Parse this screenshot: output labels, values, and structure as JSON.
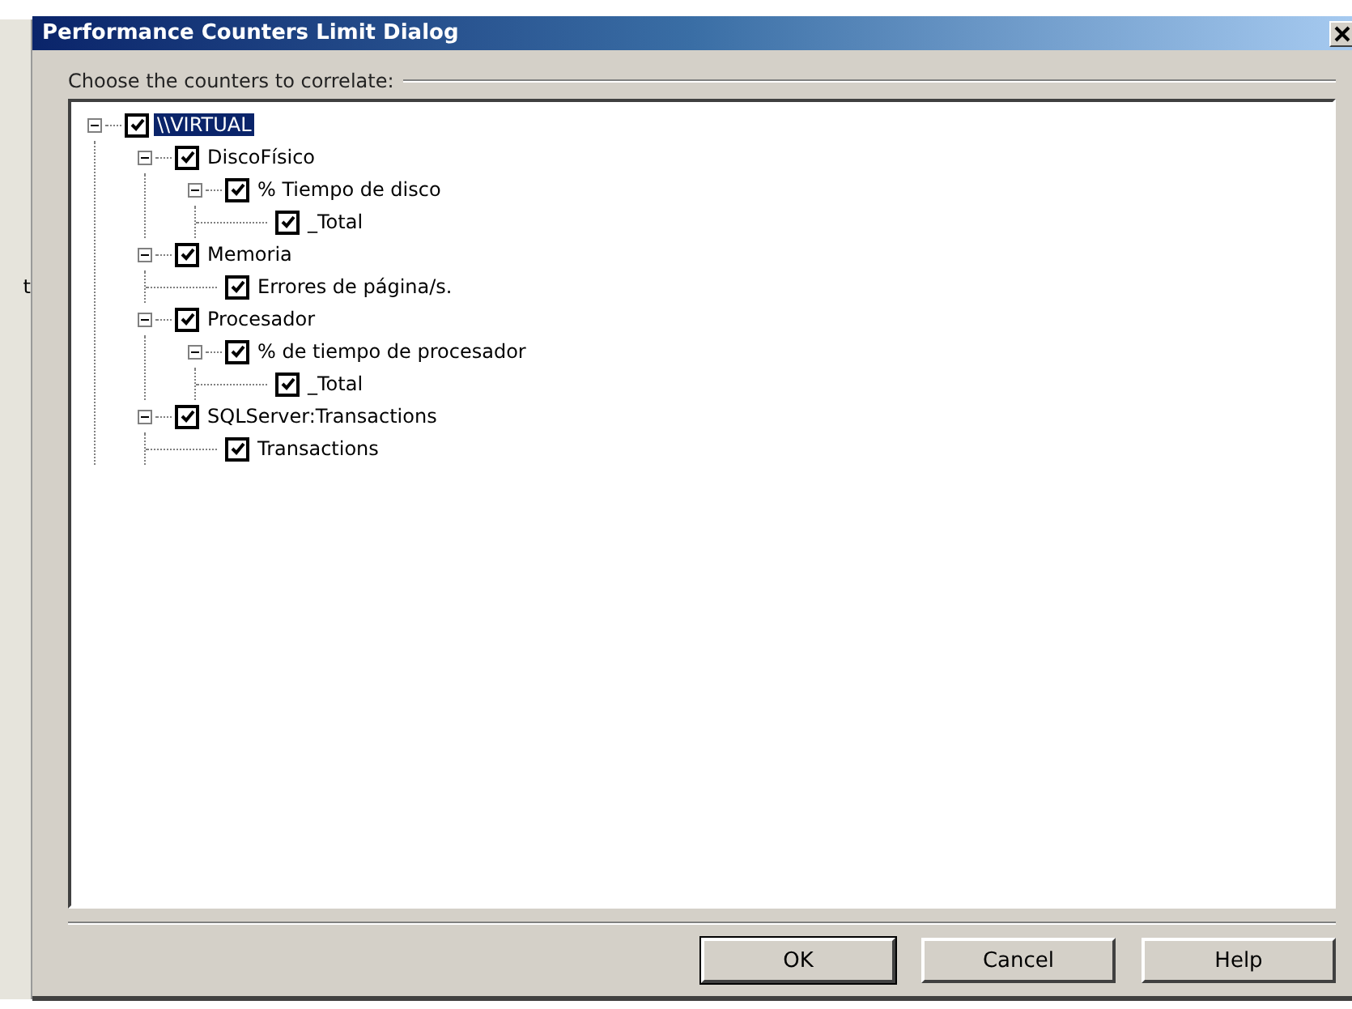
{
  "background": {
    "text_fragment": "t"
  },
  "window": {
    "title": "Performance Counters Limit Dialog"
  },
  "group_label": "Choose the counters to correlate:",
  "tree": [
    {
      "label": "\\\\VIRTUAL",
      "checked": true,
      "selected": true,
      "expanded": true,
      "children": [
        {
          "label": "DiscoFísico",
          "checked": true,
          "selected": false,
          "expanded": true,
          "children": [
            {
              "label": "% Tiempo de disco",
              "checked": true,
              "selected": false,
              "expanded": true,
              "children": [
                {
                  "label": "_Total",
                  "checked": true,
                  "selected": false
                }
              ]
            }
          ]
        },
        {
          "label": "Memoria",
          "checked": true,
          "selected": false,
          "expanded": true,
          "children": [
            {
              "label": "Errores de página/s.",
              "checked": true,
              "selected": false
            }
          ]
        },
        {
          "label": "Procesador",
          "checked": true,
          "selected": false,
          "expanded": true,
          "children": [
            {
              "label": "% de tiempo de procesador",
              "checked": true,
              "selected": false,
              "expanded": true,
              "children": [
                {
                  "label": "_Total",
                  "checked": true,
                  "selected": false
                }
              ]
            }
          ]
        },
        {
          "label": "SQLServer:Transactions",
          "checked": true,
          "selected": false,
          "expanded": true,
          "children": [
            {
              "label": "Transactions",
              "checked": true,
              "selected": false
            }
          ]
        }
      ]
    }
  ],
  "buttons": [
    {
      "label": "OK",
      "default": true
    },
    {
      "label": "Cancel",
      "default": false
    },
    {
      "label": "Help",
      "default": false
    }
  ]
}
